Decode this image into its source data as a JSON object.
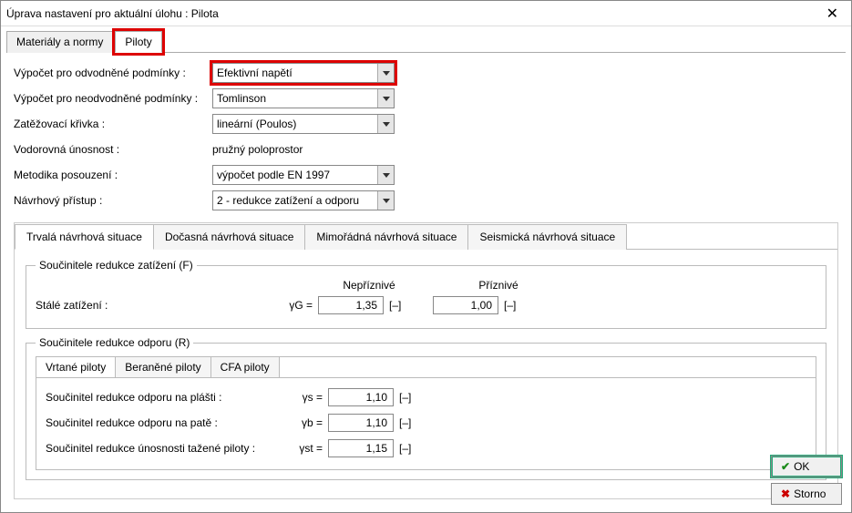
{
  "window": {
    "title": "Úprava nastavení pro aktuální úlohu : Pilota"
  },
  "mainTabs": {
    "materials": "Materiály a normy",
    "piles": "Piloty"
  },
  "settings": {
    "drained": {
      "label": "Výpočet pro odvodněné podmínky :",
      "value": "Efektivní napětí"
    },
    "undrained": {
      "label": "Výpočet pro neodvodněné podmínky :",
      "value": "Tomlinson"
    },
    "loadcurve": {
      "label": "Zatěžovací křivka :",
      "value": "lineární (Poulos)"
    },
    "horizontal": {
      "label": "Vodorovná únosnost :",
      "value": "pružný poloprostor"
    },
    "method": {
      "label": "Metodika posouzení :",
      "value": "výpočet podle EN 1997"
    },
    "approach": {
      "label": "Návrhový přístup :",
      "value": "2 - redukce zatížení a odporu"
    }
  },
  "situationTabs": {
    "perm": "Trvalá návrhová situace",
    "temp": "Dočasná návrhová situace",
    "acc": "Mimořádná návrhová situace",
    "seis": "Seismická návrhová situace"
  },
  "loadGroup": {
    "legend": "Součinitele redukce zatížení (F)",
    "hdrUnfav": "Nepříznivé",
    "hdrFav": "Příznivé",
    "permLoad": {
      "label": "Stálé zatížení :",
      "sym": "γG =",
      "unfav": "1,35",
      "fav": "1,00",
      "unit": "[–]"
    }
  },
  "resGroup": {
    "legend": "Součinitele redukce odporu (R)",
    "pileTabs": {
      "bored": "Vrtané piloty",
      "driven": "Beraněné piloty",
      "cfa": "CFA piloty"
    },
    "shaft": {
      "label": "Součinitel redukce odporu na plášti :",
      "sym": "γs =",
      "val": "1,10",
      "unit": "[–]"
    },
    "base": {
      "label": "Součinitel redukce odporu na patě :",
      "sym": "γb =",
      "val": "1,10",
      "unit": "[–]"
    },
    "tension": {
      "label": "Součinitel redukce únosnosti tažené piloty :",
      "sym": "γst =",
      "val": "1,15",
      "unit": "[–]"
    }
  },
  "buttons": {
    "ok": "OK",
    "cancel": "Storno"
  }
}
